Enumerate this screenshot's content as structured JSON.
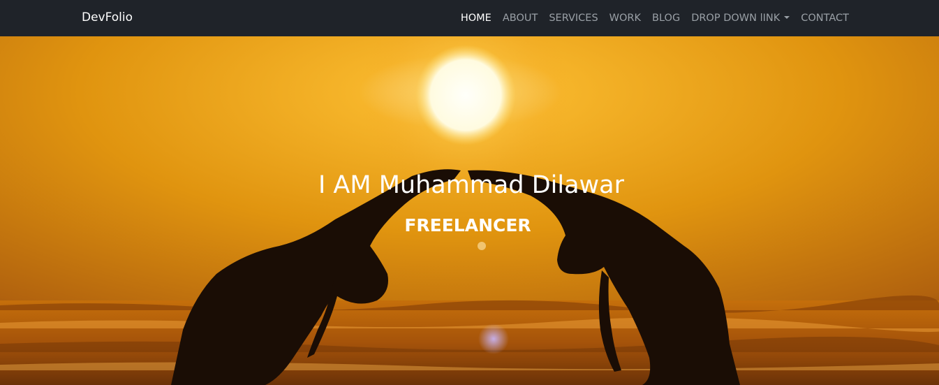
{
  "navbar": {
    "brand": "DevFolio",
    "items": [
      {
        "label": "HOME",
        "active": true
      },
      {
        "label": "ABOUT",
        "active": false
      },
      {
        "label": "SERVICES",
        "active": false
      },
      {
        "label": "WORK",
        "active": false
      },
      {
        "label": "BLOG",
        "active": false
      },
      {
        "label": "DROP DOWN lINK",
        "active": false,
        "dropdown": true
      },
      {
        "label": "CONTACT",
        "active": false
      }
    ]
  },
  "hero": {
    "title": "I AM Muhammad Dilawar",
    "subtitle": "FREELANCER",
    "background": "sunset-beach-yoga-photo"
  },
  "colors": {
    "navbar_bg": "#1f2329",
    "nav_text": "#9aa0a6",
    "nav_active": "#ffffff",
    "sky_orange": "#e0940f"
  }
}
